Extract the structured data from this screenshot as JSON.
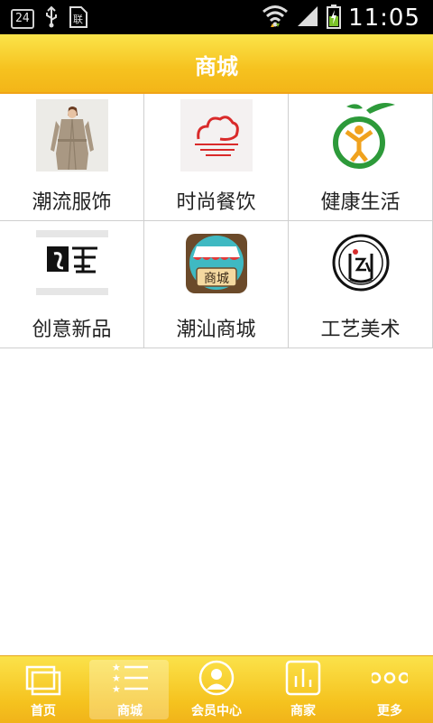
{
  "status_bar": {
    "notification_badge": "24",
    "time": "11:05",
    "icons": [
      "usb-icon",
      "sim-icon",
      "wifi-icon",
      "signal-icon",
      "battery-icon"
    ]
  },
  "header": {
    "title": "商城"
  },
  "categories": [
    {
      "label": "潮流服饰",
      "icon": "coat-photo"
    },
    {
      "label": "时尚餐饮",
      "icon": "dining-logo"
    },
    {
      "label": "健康生活",
      "icon": "health-logo"
    },
    {
      "label": "创意新品",
      "icon": "creative-logo"
    },
    {
      "label": "潮汕商城",
      "icon": "mall-logo"
    },
    {
      "label": "工艺美术",
      "icon": "art-logo"
    }
  ],
  "tabbar": {
    "active": "商城",
    "tabs": [
      {
        "label": "首页",
        "icon": "home-icon"
      },
      {
        "label": "商城",
        "icon": "list-icon"
      },
      {
        "label": "会员中心",
        "icon": "member-icon"
      },
      {
        "label": "商家",
        "icon": "merchant-icon"
      },
      {
        "label": "更多",
        "icon": "more-icon"
      }
    ]
  },
  "colors": {
    "accent": "#f6c21f",
    "header_text": "#ffffff",
    "label_text": "#222222"
  }
}
